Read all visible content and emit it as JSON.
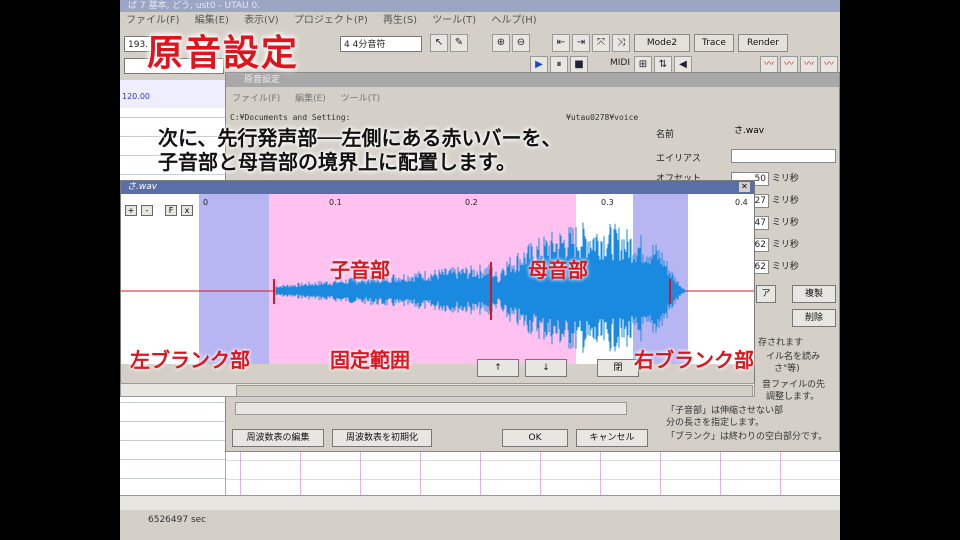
{
  "app": {
    "title": "ば 7 基本, どう, ust0 - UTAU 0.",
    "menus": [
      "ファイル(F)",
      "編集(E)",
      "表示(V)",
      "プロジェクト(P)",
      "再生(S)",
      "ツール(T)",
      "ヘルプ(H)"
    ],
    "toolbar": {
      "tempo_value": "193.",
      "note_length": "4 4分音符",
      "mode2": "Mode2",
      "trace": "Trace",
      "render": "Render",
      "midi": "MIDI"
    },
    "ruler_value": "120.00",
    "status_text": "6526497 sec"
  },
  "dialog": {
    "title": "原音設定",
    "menus": [
      "ファイル(F)",
      "編集(E)",
      "ツール(T)"
    ],
    "path_left": "C:¥Documents and Setting:",
    "path_right": "¥utau0278¥voice",
    "fields": {
      "name_label": "名前",
      "name_value": "さ.wav",
      "alias_label": "エイリアス",
      "alias_value": "",
      "offset_label": "オフセット"
    },
    "values": [
      {
        "value": "50",
        "unit": "ミリ秒"
      },
      {
        "value": "27",
        "unit": "ミリ秒"
      },
      {
        "value": "47",
        "unit": "ミリ秒"
      },
      {
        "value": "62",
        "unit": "ミリ秒"
      },
      {
        "value": "62",
        "unit": "ミリ秒"
      }
    ],
    "buttons": {
      "side1": "ア",
      "side2": "複製",
      "side3": "削除",
      "freq_edit": "周波数表の編集",
      "freq_init": "周波数表を初期化",
      "ok": "OK",
      "cancel": "キャンセル",
      "up": "↑",
      "down": "↓",
      "close": "閉"
    },
    "notes": [
      "存されます",
      "イル名を読み",
      "さ\"等)",
      "音ファイルの先",
      "調整します。",
      "「子音部」は伸縮させない部",
      "分の長さを指定します。",
      "「ブランク」は終わりの空白部分です。"
    ]
  },
  "wave": {
    "title": "さ.wav",
    "zoom_buttons": [
      "+",
      "-",
      "F",
      "x"
    ],
    "tick_labels": [
      "0",
      "0.1",
      "0.2",
      "0.3",
      "0.4"
    ]
  },
  "overlay": {
    "title": "原音設定",
    "caption_line1": "次に、先行発声部──左側にある赤いバーを、",
    "caption_line2": "子音部と母音部の境界上に配置します。",
    "label_consonant": "子音部",
    "label_vowel": "母音部",
    "label_left_blank": "左ブランク部",
    "label_fixed": "固定範囲",
    "label_right_blank": "右ブランク部"
  },
  "colors": {
    "wave_blue": "#1a8ae0",
    "left_blank": "#b8b6f2",
    "fixed_pink": "#ffc2f0",
    "marker_red": "#e0141c",
    "overlay_red": "#e0141c"
  }
}
